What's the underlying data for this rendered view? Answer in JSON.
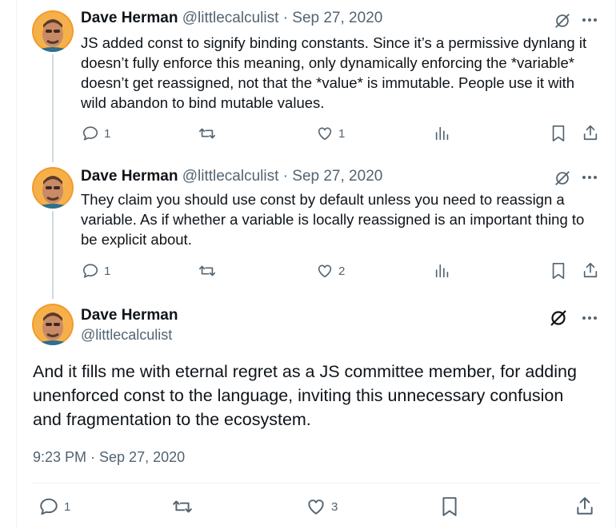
{
  "tweets": [
    {
      "name": "Dave Herman",
      "handle": "@littlecalculist",
      "date": "Sep 27, 2020",
      "separator": " · ",
      "text": "JS added const to signify binding constants. Since it’s a permissive dynlang it doesn’t fully enforce this meaning, only dynamically enforcing the *variable* doesn’t get reassigned, not that the *value* is immutable. People use it with wild abandon to bind mutable values.",
      "replies": "1",
      "likes": "1"
    },
    {
      "name": "Dave Herman",
      "handle": "@littlecalculist",
      "date": "Sep 27, 2020",
      "separator": " · ",
      "text": "They claim you should use const by default unless you need to reassign a variable. As if whether a variable is locally reassigned is an important thing to be explicit about.",
      "replies": "1",
      "likes": "2"
    }
  ],
  "main": {
    "name": "Dave Herman",
    "handle": "@littlecalculist",
    "text": "And it fills me with eternal regret as a JS committee member, for adding unenforced const to the language, inviting this unnecessary confusion and fragmentation to the ecosystem.",
    "timestamp": "9:23 PM · Sep 27, 2020",
    "replies": "1",
    "likes": "3"
  },
  "icons": [
    "grok-icon",
    "more-icon",
    "reply-icon",
    "retweet-icon",
    "like-icon",
    "views-icon",
    "bookmark-icon",
    "share-icon"
  ],
  "colors": {
    "text": "#0f1419",
    "secondary": "#536471",
    "thread_line": "#cfd9de",
    "divider": "#eff3f4"
  }
}
